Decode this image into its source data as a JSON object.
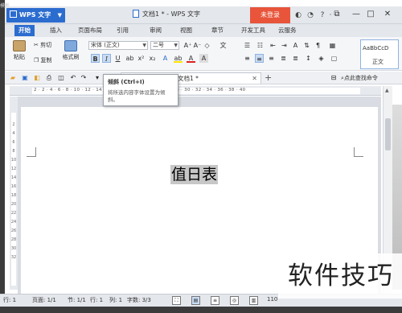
{
  "left_strip_text": "模板",
  "titlebar": {
    "app_menu_label": "WPS 文字",
    "doc_title": "文档1 * - WPS 文字",
    "login_label": "未登录",
    "icons": [
      "skin-icon",
      "chat-icon",
      "shirt-icon",
      "help-icon"
    ]
  },
  "window_controls": {
    "restore": "⧉",
    "minimize": "—",
    "maximize": "□",
    "close": "✕"
  },
  "ribbon_tabs": [
    "开始",
    "插入",
    "页面布局",
    "引用",
    "审阅",
    "视图",
    "章节",
    "开发工具",
    "云服务"
  ],
  "ribbon": {
    "paste": "粘贴",
    "cut": "剪切",
    "copy": "复制",
    "format_painter": "格式刷",
    "font_name": "宋体 (正文)",
    "font_size": "二号",
    "bold": "B",
    "italic": "I",
    "underline": "U",
    "style_preview": "AaBbCcD",
    "style_name": "正文"
  },
  "quickbar": {
    "doc_tab": "文档1 *",
    "find_command": "点此查找命令"
  },
  "tooltip": {
    "title": "倾斜 (Ctrl+I)",
    "desc": "将所选内容字体设置为倾斜。"
  },
  "ruler_numbers": "2 · 2 · 4 · 6 · 8 · 10 · 12 · 14 · 16 · 18 · 20 · 22 · 24 · 26 · 28 · 30 · 32 · 34 · 36 · 38 · 40",
  "vruler_numbers": [
    "2",
    "4",
    "6",
    "8",
    "10",
    "12",
    "14",
    "16",
    "18",
    "20",
    "22",
    "24",
    "26",
    "28",
    "30",
    "32"
  ],
  "document": {
    "heading": "值日表"
  },
  "statusbar": {
    "row_col": "行: 1",
    "page_info": "页码: 1",
    "pages": "页面: 1/1",
    "section": "节: 1/1",
    "line": "行: 1",
    "column": "列: 1",
    "wordcount": "字数: 3/3",
    "zoom": "110"
  },
  "watermark": "软件技巧",
  "colors": {
    "accent": "#2b6ccf",
    "login": "#e8553b",
    "heading_highlight": "#c7c7c7"
  }
}
